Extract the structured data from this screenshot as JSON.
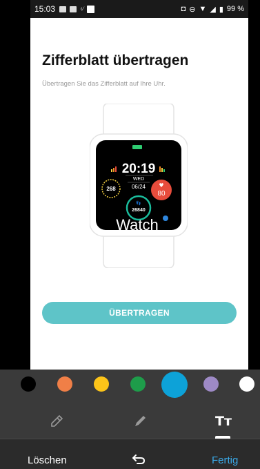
{
  "status_bar": {
    "time": "15:03",
    "battery": "99 %"
  },
  "screen": {
    "title": "Zifferblatt übertragen",
    "subtitle": "Übertragen Sie das Zifferblatt auf Ihre Uhr.",
    "primary_button": "ÜBERTRAGEN"
  },
  "watch_face": {
    "time": "20:19",
    "day": "WED",
    "date": "06/24",
    "left_dial_value": "268",
    "heart_rate": "80",
    "steps": "26840",
    "label": "Watch",
    "accent_colors": {
      "battery": "#2ecc71",
      "left_dial": "#f4d03f",
      "heart": "#e74c3c",
      "steps_ring": "#1abc9c",
      "dot": "#2e86de"
    }
  },
  "editor": {
    "palette": [
      {
        "name": "black",
        "hex": "#000000"
      },
      {
        "name": "orange",
        "hex": "#f07f47"
      },
      {
        "name": "yellow",
        "hex": "#fcc419"
      },
      {
        "name": "green",
        "hex": "#1e9c4a"
      },
      {
        "name": "blue",
        "hex": "#0da2d8",
        "selected": true
      },
      {
        "name": "purple",
        "hex": "#9e8ac6"
      },
      {
        "name": "white",
        "hex": "#ffffff"
      }
    ],
    "tools": {
      "marker": "marker-icon",
      "pen": "pen-icon",
      "text": "Tт"
    },
    "actions": {
      "delete": "Löschen",
      "undo": "undo-icon",
      "done": "Fertig"
    }
  }
}
